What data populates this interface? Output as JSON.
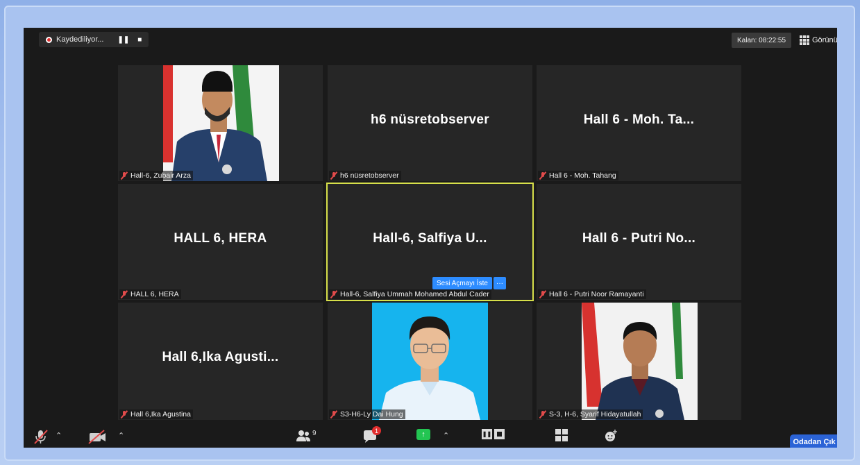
{
  "topbar": {
    "recording_label": "Kaydediliyor...",
    "remaining_label": "Kalan: 08:22:55",
    "view_label": "Görünüm"
  },
  "tiles": [
    {
      "big": "",
      "name": "Hall-6, Zubair Arza"
    },
    {
      "big": "h6 nüsretobserver",
      "name": "h6 nüsretobserver"
    },
    {
      "big": "Hall 6 - Moh. Ta...",
      "name": "Hall 6 - Moh. Tahang"
    },
    {
      "big": "HALL 6, HERA",
      "name": "HALL 6, HERA"
    },
    {
      "big": "Hall-6, Salfiya U...",
      "name": "Hall-6, Salfiya Ummah Mohamed Abdul Cader"
    },
    {
      "big": "Hall 6 - Putri No...",
      "name": "Hall 6 - Putri Noor Ramayanti"
    },
    {
      "big": "Hall 6,Ika Agusti...",
      "name": "Hall 6,Ika Agustina"
    },
    {
      "big": "",
      "name": "S3-H6-Ly Dai Hung"
    },
    {
      "big": "",
      "name": "S-3, H-6, Syarif Hidayatullah"
    }
  ],
  "unmute_request": {
    "label": "Sesi Açmayı İste",
    "more": "···"
  },
  "bottombar": {
    "participants_count": "9",
    "chat_badge": "1",
    "leave_label": "Odadan Çık"
  }
}
